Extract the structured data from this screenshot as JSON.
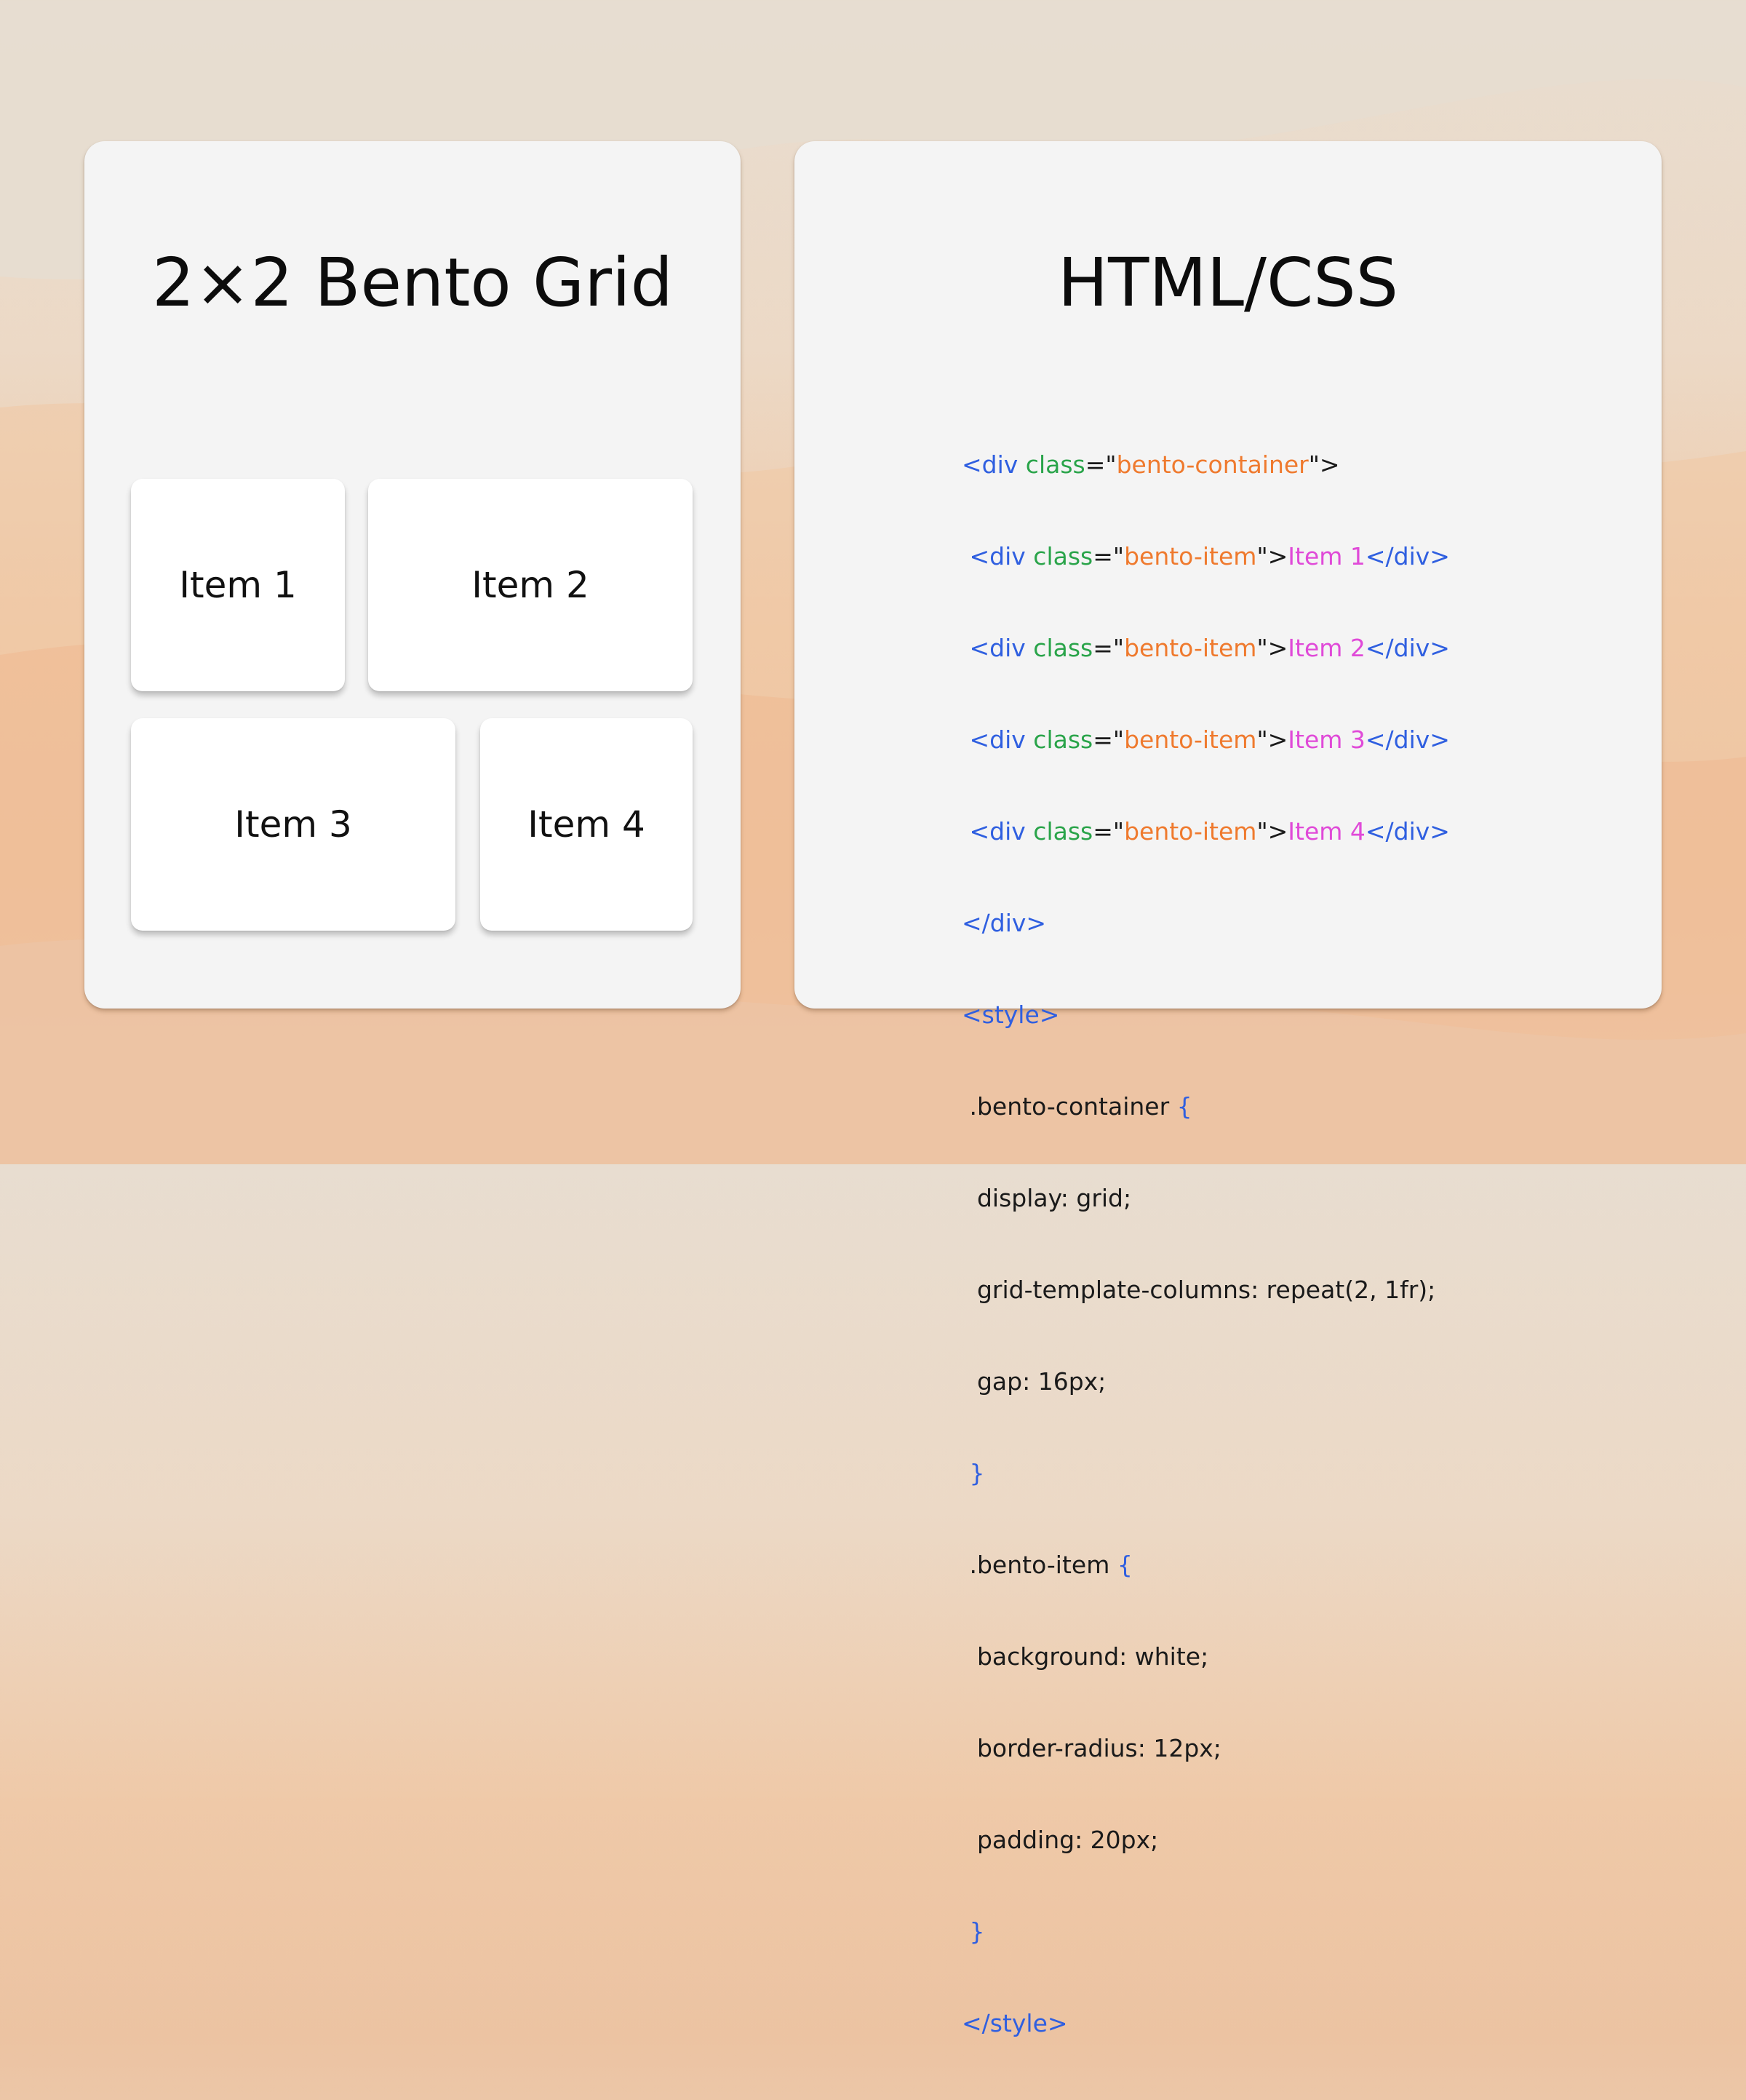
{
  "left_card": {
    "title": "2×2 Bento Grid",
    "items": [
      "Item 1",
      "Item 2",
      "Item 3",
      "Item 4"
    ]
  },
  "right_card": {
    "title": "HTML/CSS",
    "code": {
      "l1": {
        "open": "<div ",
        "attr": "class",
        "eq": "=\"",
        "value": "bento-container",
        "close": "\">"
      },
      "l2": {
        "open": "<div ",
        "attr": "class",
        "eq": "=\"",
        "value": "bento-item",
        "close": "\">",
        "text": "Item 1",
        "end": "</div>"
      },
      "l3": {
        "open": "<div ",
        "attr": "class",
        "eq": "=\"",
        "value": "bento-item",
        "close": "\">",
        "text": "Item 2",
        "end": "</div>"
      },
      "l4": {
        "open": "<div ",
        "attr": "class",
        "eq": "=\"",
        "value": "bento-item",
        "close": "\">",
        "text": "Item 3",
        "end": "</div>"
      },
      "l5": {
        "open": "<div ",
        "attr": "class",
        "eq": "=\"",
        "value": "bento-item",
        "close": "\">",
        "text": "Item 4",
        "end": "</div>"
      },
      "l6": "</div>",
      "l7": "<style>",
      "l8": {
        "selector": ".bento-container",
        "brace": "{"
      },
      "l9": "display: grid;",
      "l10": "grid-template-columns: repeat(2, 1fr);",
      "l11": "gap: 16px;",
      "l12": "}",
      "l13": {
        "selector": ".bento-item",
        "brace": "{"
      },
      "l14": "background: white;",
      "l15": "border-radius: 12px;",
      "l16": "padding: 20px;",
      "l17": "}",
      "l18": "</style>"
    }
  },
  "colors": {
    "tag": "#2f5fe0",
    "attribute": "#2aa44a",
    "string": "#ef7a2e",
    "text": "#e04ad8",
    "card_background": "#f4f4f4"
  }
}
